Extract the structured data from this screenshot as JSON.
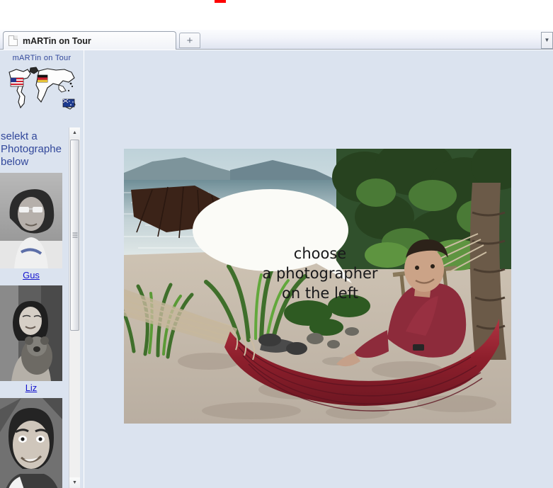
{
  "browser": {
    "tab": {
      "title": "mARTin on Tour",
      "favicon": "document-icon"
    },
    "new_tab_label": "+",
    "tab_list_glyph": "▼"
  },
  "page": {
    "header": {
      "logo_caption": "mARTin on Tour",
      "logo_graphic": "world-map-with-flags"
    },
    "sidebar": {
      "heading_lines": [
        "selekt a",
        "Photographe",
        "below"
      ],
      "photographers": [
        {
          "name": "Gus",
          "thumb": "portrait-man-sunglasses-curly-hair"
        },
        {
          "name": "Liz",
          "thumb": "portrait-woman-holding-koala"
        },
        {
          "name": "",
          "thumb": "portrait-man-funny-face"
        }
      ],
      "scrollbar": {
        "up_glyph": "▲",
        "down_glyph": "▼"
      }
    },
    "main": {
      "photo_alt": "man-relaxing-in-red-hammock-on-tropical-beach",
      "speech_bubble_lines": [
        "choose",
        "a photographer",
        "on the left"
      ]
    }
  },
  "colors": {
    "page_background": "#dbe3ef",
    "link": "#1414cf",
    "heading": "#32489b",
    "red_marker": "#fe0000"
  }
}
